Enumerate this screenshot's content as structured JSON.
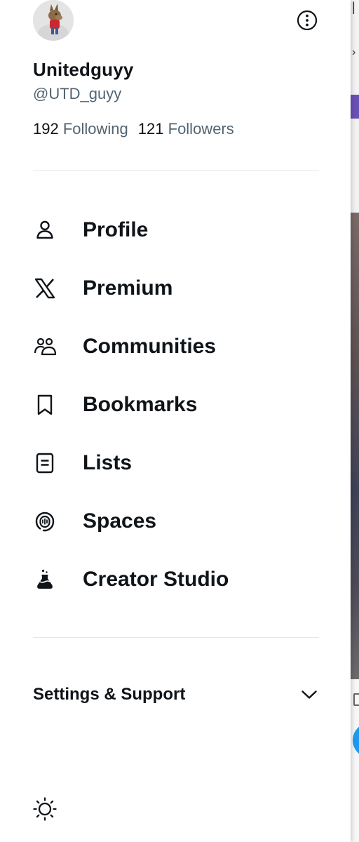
{
  "profile": {
    "display_name": "Unitedguyy",
    "handle": "@UTD_guyy",
    "following_count": "192",
    "following_label": "Following",
    "followers_count": "121",
    "followers_label": "Followers"
  },
  "nav": {
    "items": [
      {
        "label": "Profile",
        "icon": "person-icon"
      },
      {
        "label": "Premium",
        "icon": "x-logo-icon"
      },
      {
        "label": "Communities",
        "icon": "communities-icon"
      },
      {
        "label": "Bookmarks",
        "icon": "bookmark-icon"
      },
      {
        "label": "Lists",
        "icon": "list-icon"
      },
      {
        "label": "Spaces",
        "icon": "spaces-icon"
      },
      {
        "label": "Creator Studio",
        "icon": "creator-studio-icon"
      }
    ]
  },
  "settings": {
    "label": "Settings & Support"
  },
  "colors": {
    "text_primary": "#0f1419",
    "text_secondary": "#536471",
    "divider": "#e6e6e6"
  }
}
